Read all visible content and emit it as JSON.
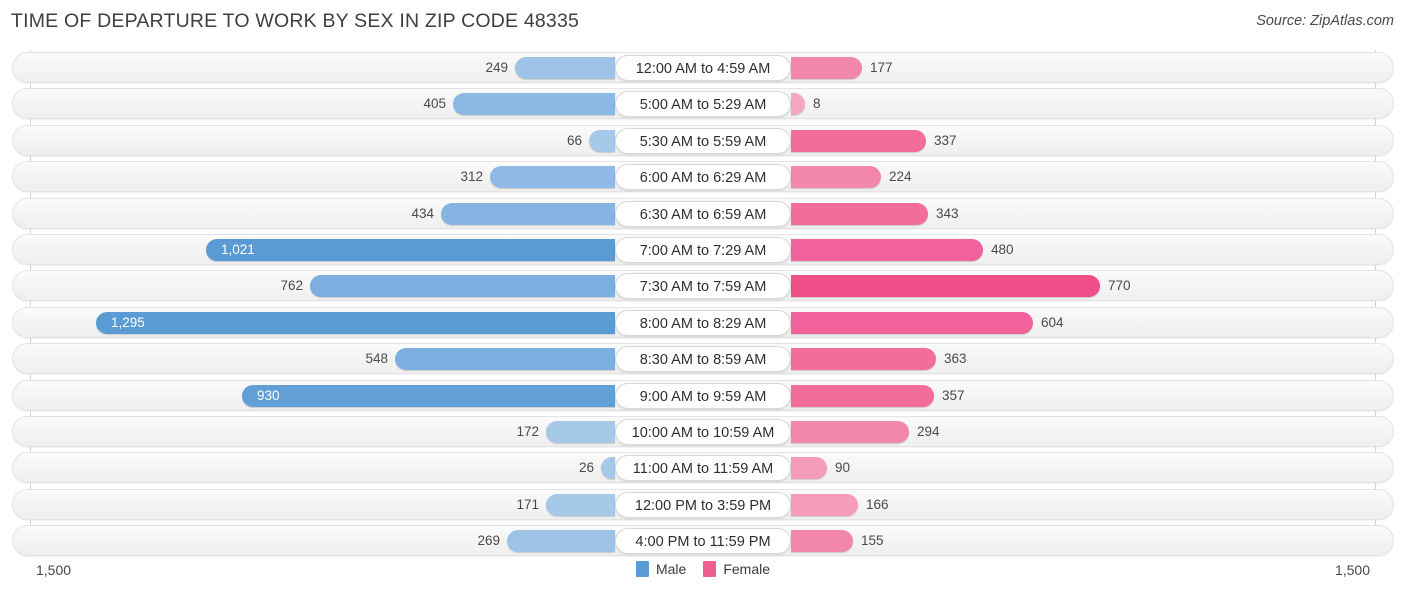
{
  "header": {
    "title": "TIME OF DEPARTURE TO WORK BY SEX IN ZIP CODE 48335",
    "source": "Source: ZipAtlas.com"
  },
  "footer": {
    "axis_max_left": "1,500",
    "axis_max_right": "1,500",
    "legend": [
      {
        "label": "Male",
        "color": "#5b9bd5",
        "swatch_name": "legend-swatch-male"
      },
      {
        "label": "Female",
        "color": "#ef5f8e",
        "swatch_name": "legend-swatch-female"
      }
    ]
  },
  "chart_data": {
    "type": "bar",
    "subtype": "diverging-bidirectional-bar",
    "title": "TIME OF DEPARTURE TO WORK BY SEX IN ZIP CODE 48335",
    "xlabel": "",
    "ylabel": "",
    "xlim": [
      -1500,
      1500
    ],
    "axis_max": 1500,
    "grid": false,
    "legend_position": "bottom-center",
    "categories": [
      "12:00 AM to 4:59 AM",
      "5:00 AM to 5:29 AM",
      "5:30 AM to 5:59 AM",
      "6:00 AM to 6:29 AM",
      "6:30 AM to 6:59 AM",
      "7:00 AM to 7:29 AM",
      "7:30 AM to 7:59 AM",
      "8:00 AM to 8:29 AM",
      "8:30 AM to 8:59 AM",
      "9:00 AM to 9:59 AM",
      "10:00 AM to 10:59 AM",
      "11:00 AM to 11:59 AM",
      "12:00 PM to 3:59 PM",
      "4:00 PM to 11:59 PM"
    ],
    "series": [
      {
        "name": "Male",
        "direction": "left",
        "color": "#5b9bd5",
        "values": [
          249,
          405,
          66,
          312,
          434,
          1021,
          762,
          1295,
          548,
          930,
          172,
          26,
          171,
          269
        ],
        "labels": [
          "249",
          "405",
          "66",
          "312",
          "434",
          "1,021",
          "762",
          "1,295",
          "548",
          "930",
          "172",
          "26",
          "171",
          "269"
        ]
      },
      {
        "name": "Female",
        "direction": "right",
        "color": "#ef5f8e",
        "values": [
          177,
          8,
          337,
          224,
          343,
          480,
          770,
          604,
          363,
          357,
          294,
          90,
          166,
          155
        ],
        "labels": [
          "177",
          "8",
          "337",
          "224",
          "343",
          "480",
          "770",
          "604",
          "363",
          "357",
          "294",
          "90",
          "166",
          "155"
        ]
      }
    ]
  },
  "render": {
    "male_colors": [
      "#9dc3e6",
      "#8cb8e4",
      "#a6c9ea",
      "#90bae5",
      "#85b4e2",
      "#5b9bd5",
      "#7cafe0",
      "#5b9bd5",
      "#7cafe0",
      "#629fd7",
      "#a6c9ea",
      "#a6c9ea",
      "#a6c9ea",
      "#9dc3e6"
    ],
    "female_colors": [
      "#f386ac",
      "#f4a7c0",
      "#f26d9c",
      "#f386ac",
      "#f26d9c",
      "#f2629a",
      "#ef4f88",
      "#f2629a",
      "#f26d9c",
      "#f26d9c",
      "#f386ac",
      "#f49cba",
      "#f49cba",
      "#f386ac"
    ],
    "male_label_inside": [
      false,
      false,
      false,
      false,
      false,
      true,
      false,
      true,
      false,
      true,
      false,
      false,
      false,
      false
    ],
    "female_label_inside": [
      false,
      false,
      false,
      false,
      false,
      false,
      false,
      false,
      false,
      false,
      false,
      false,
      false,
      false
    ]
  }
}
